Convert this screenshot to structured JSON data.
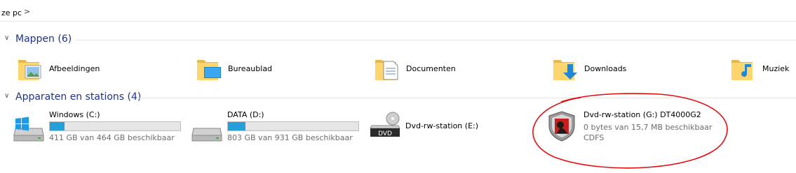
{
  "address": {
    "crumb": "ze pc",
    "chevron": ">"
  },
  "groups": {
    "folders": {
      "title": "Mappen (6)",
      "toggle": "∨"
    },
    "drives": {
      "title": "Apparaten en stations (4)",
      "toggle": "∨"
    }
  },
  "folders": [
    {
      "label": "Afbeeldingen",
      "icon": "pictures-folder-icon"
    },
    {
      "label": "Bureaublad",
      "icon": "desktop-folder-icon"
    },
    {
      "label": "Documenten",
      "icon": "documents-folder-icon"
    },
    {
      "label": "Downloads",
      "icon": "downloads-folder-icon"
    },
    {
      "label": "Muziek",
      "icon": "music-folder-icon"
    }
  ],
  "drives": [
    {
      "name": "Windows (C:)",
      "free": "411 GB van 464 GB beschikbaar",
      "used_fraction": 0.114,
      "icon": "windows-drive-icon"
    },
    {
      "name": "DATA (D:)",
      "free": "803 GB van 931 GB beschikbaar",
      "used_fraction": 0.137,
      "icon": "hard-drive-icon"
    },
    {
      "name": "Dvd-rw-station (E:)",
      "icon": "dvd-drive-icon",
      "dvd_text": "DVD"
    },
    {
      "name": "Dvd-rw-station (G:) DT4000G2",
      "free": "0 bytes van 15,7 MB beschikbaar",
      "fs": "CDFS",
      "icon": "kingston-drive-icon"
    }
  ],
  "colors": {
    "accent": "#1e3287",
    "bar": "#26a0da",
    "annotation": "#e01010"
  }
}
